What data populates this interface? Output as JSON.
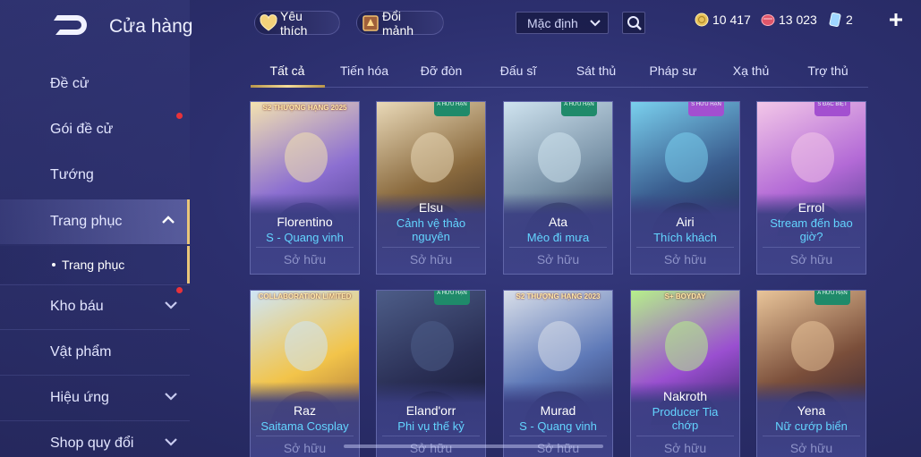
{
  "app": {
    "title": "Cửa hàng"
  },
  "header": {
    "favorite_label": "Yêu thích",
    "exchange_label": "Đổi mảnh",
    "sort_value": "Mặc định",
    "currencies": [
      {
        "icon": "gold-coin-icon",
        "value": "10 417",
        "color": "#e8c25a"
      },
      {
        "icon": "ruby-gem-icon",
        "value": "13 023",
        "color": "#e0566a"
      },
      {
        "icon": "voucher-card-icon",
        "value": "2",
        "color": "#9fd6ff"
      }
    ]
  },
  "sidebar": {
    "items": [
      {
        "label": "Đề cử",
        "chevron": false,
        "dot": false
      },
      {
        "label": "Gói đề cử",
        "chevron": false,
        "dot": true
      },
      {
        "label": "Tướng",
        "chevron": false,
        "dot": false
      },
      {
        "label": "Trang phục",
        "chevron": "up",
        "dot": false,
        "active": true
      },
      {
        "label": "Kho báu",
        "chevron": "down",
        "dot": true
      },
      {
        "label": "Vật phẩm",
        "chevron": false,
        "dot": false
      },
      {
        "label": "Hiệu ứng",
        "chevron": "down",
        "dot": false
      },
      {
        "label": "Shop quy đổi",
        "chevron": "down",
        "dot": false
      }
    ],
    "sub_item": "Trang phục"
  },
  "tabs": [
    "Tất cả",
    "Tiến hóa",
    "Đỡ đòn",
    "Đấu sĩ",
    "Sát thủ",
    "Pháp sư",
    "Xạ thủ",
    "Trợ thủ"
  ],
  "active_tab": 0,
  "cards": [
    {
      "hero": "Florentino",
      "skin": "S - Quang vinh",
      "status": "Sở hữu",
      "badge": "S2 THƯỢNG HẠNG 2025",
      "palette": [
        "#f3e2b0",
        "#8c6fd1",
        "#4b3d8f"
      ]
    },
    {
      "hero": "Elsu",
      "skin": "Cảnh vệ thảo nguyên",
      "status": "Sở hữu",
      "badge": "A HỮU HẠN",
      "palette": [
        "#e9d9b8",
        "#8a6a3e",
        "#3b2c22"
      ]
    },
    {
      "hero": "Ata",
      "skin": "Mèo đi mưa",
      "status": "Sở hữu",
      "badge": "A HỮU HẠN",
      "palette": [
        "#cfe3ef",
        "#7a93a8",
        "#2f3a55"
      ]
    },
    {
      "hero": "Airi",
      "skin": "Thích khách",
      "status": "Sở hữu",
      "badge": "S HỮU HẠN",
      "palette": [
        "#7ad0ee",
        "#3a5d8f",
        "#1f2a4f"
      ]
    },
    {
      "hero": "Errol",
      "skin": "Stream đến bao giờ?",
      "status": "Sở hữu",
      "badge": "S ĐẶC BIỆT",
      "palette": [
        "#f3c7e8",
        "#b36ad6",
        "#4a3a8c"
      ]
    },
    {
      "hero": "Raz",
      "skin": "Saitama Cosplay",
      "status": "Sở hữu",
      "badge": "COLLABORATION LIMITED",
      "palette": [
        "#cfe6f7",
        "#f2c44a",
        "#a06a3a"
      ]
    },
    {
      "hero": "Eland'orr",
      "skin": "Phi vụ thế kỷ",
      "status": "Sở hữu",
      "badge": "A HỮU HẠN",
      "palette": [
        "#4d5d88",
        "#2a2f55",
        "#151832"
      ]
    },
    {
      "hero": "Murad",
      "skin": "S - Quang vinh",
      "status": "Sở hữu",
      "badge": "S2 THƯỢNG HẠNG 2023",
      "palette": [
        "#d9dfe9",
        "#5e79b8",
        "#2a2f60"
      ]
    },
    {
      "hero": "Nakroth",
      "skin": "Producer Tia chớp",
      "status": "Sở hữu",
      "badge": "S+ BOYDAY",
      "palette": [
        "#b6f08a",
        "#9a4fd0",
        "#2b1f5a"
      ]
    },
    {
      "hero": "Yena",
      "skin": "Nữ cướp biển",
      "status": "Sở hữu",
      "badge": "A HỮU HẠN",
      "palette": [
        "#e9c59a",
        "#7a4e3a",
        "#2d2035"
      ]
    }
  ]
}
